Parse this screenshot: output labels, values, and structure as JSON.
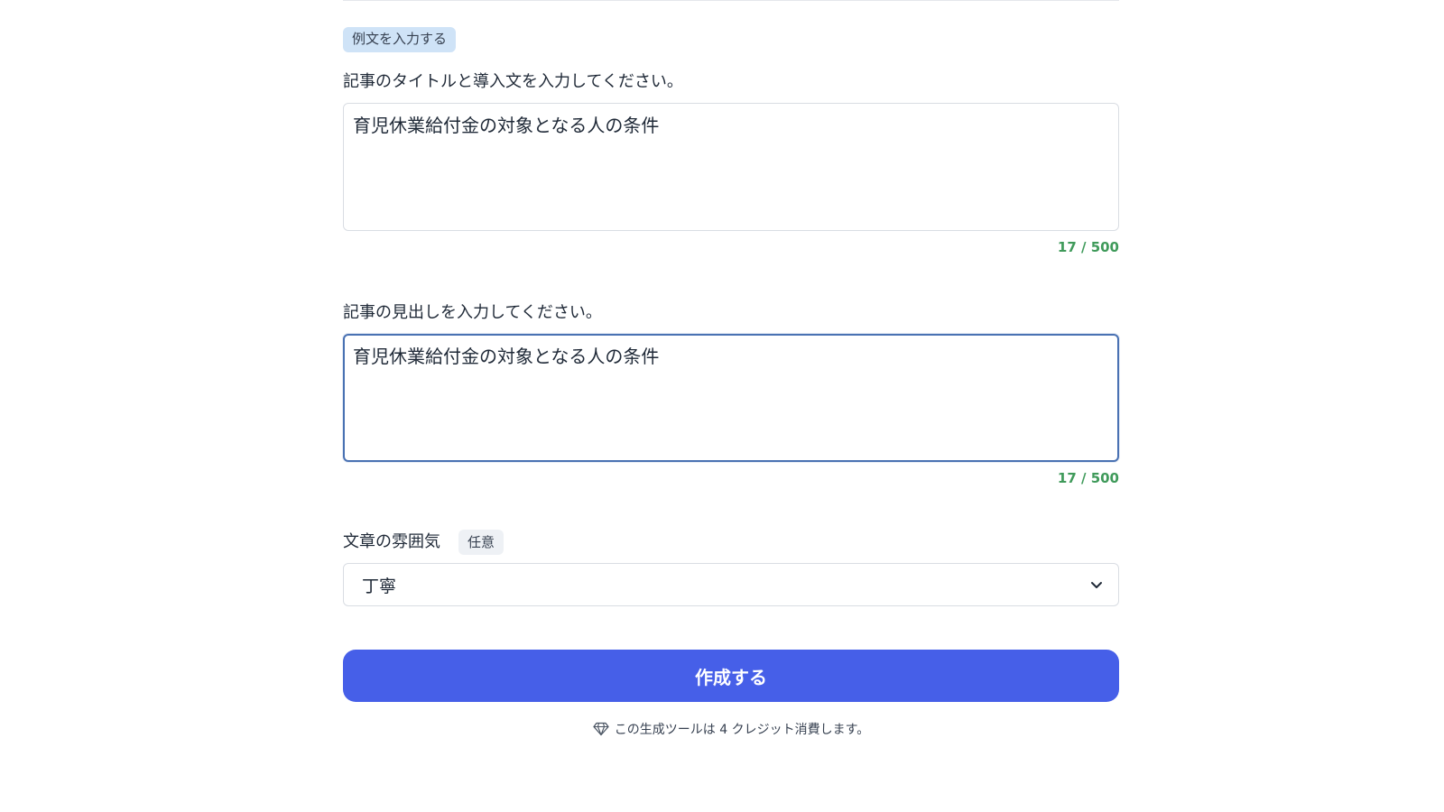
{
  "example_chip": {
    "label": "例文を入力する"
  },
  "title_field": {
    "label": "記事のタイトルと導入文を入力してください。",
    "value": "育児休業給付金の対象となる人の条件",
    "counter": "17 / 500"
  },
  "heading_field": {
    "label": "記事の見出しを入力してください。",
    "value": "育児休業給付金の対象となる人の条件",
    "counter": "17 / 500"
  },
  "tone_field": {
    "label": "文章の雰囲気",
    "badge": "任意",
    "selected": "丁寧"
  },
  "submit": {
    "label": "作成する"
  },
  "credit_note": {
    "text": "この生成ツールは 4 クレジット消費します。"
  },
  "colors": {
    "primary_button": "#465fe8",
    "counter_green": "#3f9a5a",
    "chip_blue": "#cfe3f7",
    "focus_border": "#4a72b3"
  }
}
